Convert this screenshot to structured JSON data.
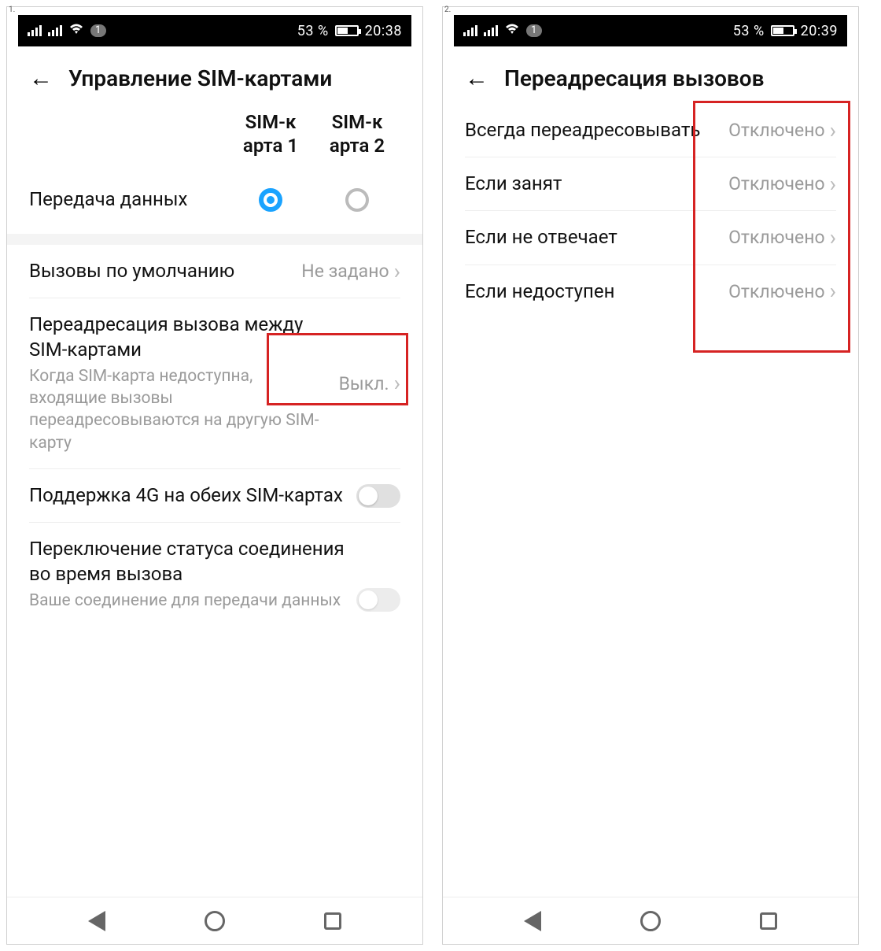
{
  "phones": {
    "left": {
      "label": "1.",
      "status": {
        "sim_badge": "1",
        "battery_pct": "53 %",
        "time": "20:38",
        "battery_fill_pct": 53
      },
      "title": "Управление SIM-картами",
      "sim_cols": [
        "SIM-к арта 1",
        "SIM-к арта 2"
      ],
      "rows": {
        "data": {
          "label": "Передача данных"
        },
        "default_calls": {
          "label": "Вызовы по умолчанию",
          "value": "Не задано"
        },
        "forward": {
          "label": "Переадресация вызова между SIM-картами",
          "sub": "Когда SIM-карта недоступна, входящие вызовы переадресовываются на другую SIM-карту",
          "value": "Выкл."
        },
        "support4g": {
          "label": "Поддержка 4G на обеих SIM-картах"
        },
        "switch_status": {
          "label": "Переключение статуса соединения во время вызова",
          "sub": "Ваше соединение для передачи данных"
        }
      }
    },
    "right": {
      "label": "2.",
      "status": {
        "sim_badge": "1",
        "battery_pct": "53 %",
        "time": "20:39",
        "battery_fill_pct": 53
      },
      "title": "Переадресация вызовов",
      "items": [
        {
          "label": "Всегда переадресовывать",
          "value": "Отключено"
        },
        {
          "label": "Если занят",
          "value": "Отключено"
        },
        {
          "label": "Если не отвечает",
          "value": "Отключено"
        },
        {
          "label": "Если недоступен",
          "value": "Отключено"
        }
      ]
    }
  }
}
